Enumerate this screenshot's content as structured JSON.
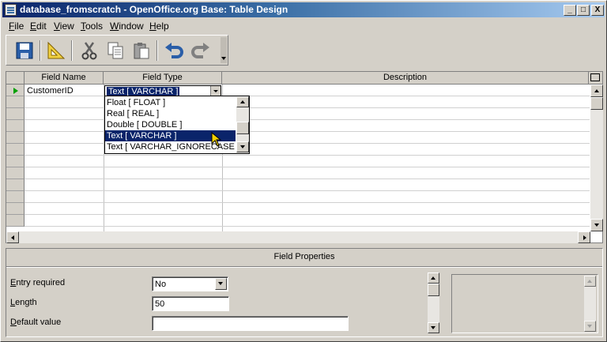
{
  "window": {
    "title": "database_fromscratch - OpenOffice.org Base: Table Design",
    "controls": {
      "minimize": "_",
      "maximize": "□",
      "close": "X"
    }
  },
  "menu": [
    {
      "label": "File",
      "accel": "F",
      "rest": "ile"
    },
    {
      "label": "Edit",
      "accel": "E",
      "rest": "dit"
    },
    {
      "label": "View",
      "accel": "V",
      "rest": "iew"
    },
    {
      "label": "Tools",
      "accel": "T",
      "rest": "ools"
    },
    {
      "label": "Window",
      "accel": "W",
      "rest": "indow"
    },
    {
      "label": "Help",
      "accel": "H",
      "rest": "elp"
    }
  ],
  "toolbar": {
    "icons": [
      "save-icon",
      "table-index-design-icon",
      "cut-icon",
      "copy-icon",
      "paste-icon",
      "undo-icon",
      "redo-icon"
    ]
  },
  "grid": {
    "headers": {
      "field_name": "Field Name",
      "field_type": "Field Type",
      "description": "Description"
    },
    "rows": [
      {
        "field_name": "CustomerID",
        "field_type": "Text [ VARCHAR ]",
        "description": ""
      }
    ]
  },
  "type_dropdown": {
    "selected": "Text [ VARCHAR ]",
    "options": [
      "Float [ FLOAT ]",
      "Real [ REAL ]",
      "Double [ DOUBLE ]",
      "Text [ VARCHAR ]",
      "Text [ VARCHAR_IGNORECASE ]"
    ],
    "highlighted_index": 3
  },
  "field_properties": {
    "title": "Field Properties",
    "entry_required": {
      "label": "Entry required",
      "accel": "E",
      "rest": "ntry required",
      "value": "No"
    },
    "length": {
      "label": "Length",
      "accel": "L",
      "rest": "ength",
      "value": "50"
    },
    "default_value": {
      "label": "Default value",
      "accel": "D",
      "rest": "efault value",
      "value": ""
    }
  },
  "colors": {
    "title_active": "#0a246a",
    "selection": "#0a246a",
    "face": "#d4d0c8"
  }
}
